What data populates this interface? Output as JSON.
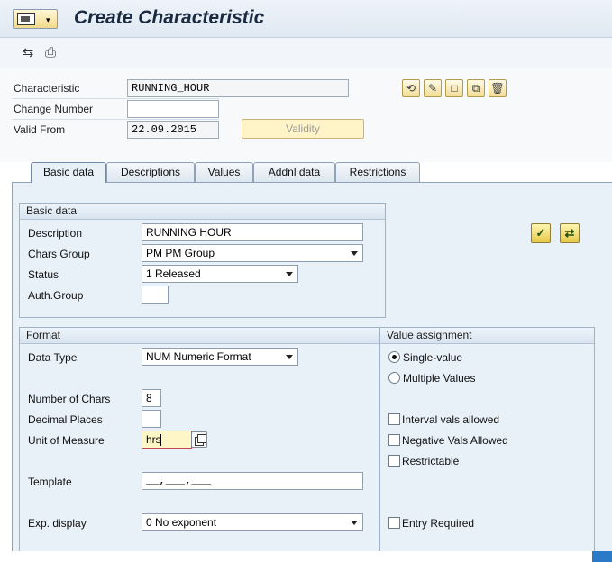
{
  "window": {
    "title": "Create Characteristic"
  },
  "header": {
    "characteristic": {
      "label": "Characteristic",
      "value": "RUNNING_HOUR"
    },
    "change_number": {
      "label": "Change Number",
      "value": ""
    },
    "valid_from": {
      "label": "Valid From",
      "value": "22.09.2015"
    },
    "validity_button": "Validity"
  },
  "tabs": [
    {
      "label": "Basic data",
      "active": true
    },
    {
      "label": "Descriptions"
    },
    {
      "label": "Values"
    },
    {
      "label": "Addnl data"
    },
    {
      "label": "Restrictions"
    }
  ],
  "basic_data_group": {
    "title": "Basic data",
    "description": {
      "label": "Description",
      "value": "RUNNING HOUR"
    },
    "chars_group": {
      "label": "Chars Group",
      "value": "PM PM Group"
    },
    "status": {
      "label": "Status",
      "value": "1 Released"
    },
    "auth_group": {
      "label": "Auth.Group",
      "value": ""
    }
  },
  "format_group": {
    "title": "Format",
    "data_type": {
      "label": "Data Type",
      "value": "NUM Numeric Format"
    },
    "number_of_chars": {
      "label": "Number of Chars",
      "value": "8"
    },
    "decimal_places": {
      "label": "Decimal Places",
      "value": ""
    },
    "unit_of_measure": {
      "label": "Unit of Measure",
      "value": "hrs"
    },
    "template": {
      "label": "Template",
      "value": "__,___,___"
    },
    "exp_display": {
      "label": "Exp. display",
      "value": "0 No exponent"
    }
  },
  "value_assignment_group": {
    "title": "Value assignment",
    "single_value": {
      "label": "Single-value",
      "selected": true
    },
    "multiple_values": {
      "label": "Multiple Values",
      "selected": false
    },
    "interval_vals": {
      "label": "Interval vals allowed",
      "checked": false
    },
    "negative_vals": {
      "label": "Negative Vals Allowed",
      "checked": false
    },
    "restrictable": {
      "label": "Restrictable",
      "checked": false
    },
    "entry_required": {
      "label": "Entry Required",
      "checked": false
    }
  },
  "icons": [
    "menu-icon",
    "display-change-icon",
    "print-icon",
    "other-icon",
    "edit-icon",
    "create-icon",
    "copy-icon",
    "delete-icon",
    "check-icon",
    "refresh-icon",
    "value-help-icon"
  ]
}
